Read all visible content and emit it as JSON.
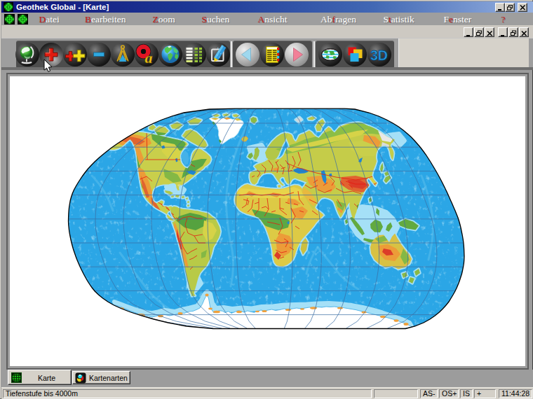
{
  "window": {
    "title": "Geothek Global - [Karte]",
    "app_icon": "globe-grid-icon",
    "controls": {
      "minimize": "minimize",
      "restore": "restore",
      "close": "close"
    }
  },
  "menu": {
    "items": [
      {
        "pre": "",
        "hot": "D",
        "post": "atei"
      },
      {
        "pre": "",
        "hot": "B",
        "post": "earbeiten"
      },
      {
        "pre": "",
        "hot": "Z",
        "post": "oom"
      },
      {
        "pre": "",
        "hot": "S",
        "post": "uchen"
      },
      {
        "pre": "",
        "hot": "A",
        "post": "nsicht"
      },
      {
        "pre": "Ab",
        "hot": "f",
        "post": "ragen"
      },
      {
        "pre": "S",
        "hot": "t",
        "post": "atistik"
      },
      {
        "pre": "F",
        "hot": "e",
        "post": "nster"
      },
      {
        "pre": "",
        "hot": "?",
        "post": ""
      }
    ]
  },
  "mdi_controls": [
    "minimize",
    "restore",
    "close",
    "minimize",
    "restore",
    "close"
  ],
  "toolbar": {
    "search_letter_glyph": "a",
    "view_3d_label": "3D",
    "groups": [
      {
        "buttons": [
          {
            "name": "desk-globe"
          },
          {
            "name": "zoom-in"
          },
          {
            "name": "zoom-in-double"
          },
          {
            "name": "zoom-out"
          },
          {
            "name": "compass"
          },
          {
            "name": "search-letter"
          },
          {
            "name": "earth-globe"
          },
          {
            "name": "data-table"
          },
          {
            "name": "edit-map"
          }
        ]
      },
      {
        "buttons": [
          {
            "name": "navigate-back"
          },
          {
            "name": "legend-list"
          },
          {
            "name": "navigate-forward"
          }
        ]
      },
      {
        "buttons": [
          {
            "name": "flat-globe"
          },
          {
            "name": "map-layers"
          },
          {
            "name": "view-3d",
            "label": "3D"
          }
        ]
      }
    ]
  },
  "tabs": [
    {
      "label": "Karte",
      "icon": "green-globe-icon",
      "active": true
    },
    {
      "label": "Kartenarten",
      "icon": "color-sphere-icon",
      "active": false
    }
  ],
  "statusbar": {
    "message": "Tiefenstufe bis 4000m",
    "panel_empty": "",
    "panels": [
      "AS-",
      "OS+",
      "IS",
      "+"
    ],
    "time": "11:44:28"
  },
  "colors": {
    "titlebar_left": "#10137a",
    "titlebar_right": "#96b1e0",
    "menubar": "#9e9e9e",
    "toolbar_bar": "#4d4d4d",
    "ocean": "#2ba6e6",
    "shelf": "#a5e0f7",
    "land_green": "#6db33f",
    "land_yellow": "#e3d44a",
    "land_orange": "#ec9c38",
    "border_red": "#e41b10",
    "graticule": "#3b6ea5"
  }
}
